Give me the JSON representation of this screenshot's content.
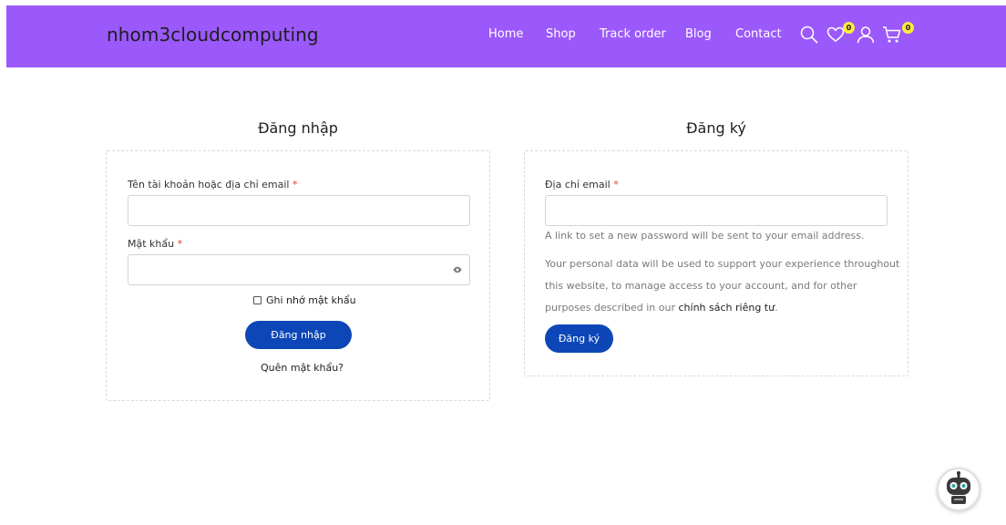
{
  "header": {
    "site_title": "nhom3cloudcomputing",
    "nav": [
      "Home",
      "Shop",
      "Track order",
      "Blog",
      "Contact"
    ],
    "wishlist_count": "0",
    "cart_count": "0"
  },
  "login": {
    "title": "Đăng nhập",
    "username_label": "Tên tài khoản hoặc địa chỉ email",
    "password_label": "Mật khẩu",
    "required_mark": "*",
    "remember_label": "Ghi nhớ mật khẩu",
    "submit_label": "Đăng nhập",
    "forgot_label": "Quên mật khẩu?"
  },
  "register": {
    "title": "Đăng ký",
    "email_label": "Địa chỉ email",
    "required_mark": "*",
    "password_note": "A link to set a new password will be sent to your email address.",
    "privacy_line1": "Your personal data will be used to support your experience throughout",
    "privacy_line2": "this website, to manage access to your account, and for other",
    "privacy_line3": "purposes described in our",
    "privacy_link": "chính sách riêng tư",
    "privacy_end": ".",
    "submit_label": "Đăng ký"
  },
  "icons": {
    "search": "search-icon",
    "wishlist": "heart-icon",
    "account": "user-icon",
    "cart": "cart-icon",
    "password_toggle": "eye-icon",
    "chat": "robot-chat-icon"
  },
  "colors": {
    "brand": "#9b59fb",
    "button": "#0d47b7",
    "badge": "#ffeb3b",
    "required": "#e53935"
  }
}
